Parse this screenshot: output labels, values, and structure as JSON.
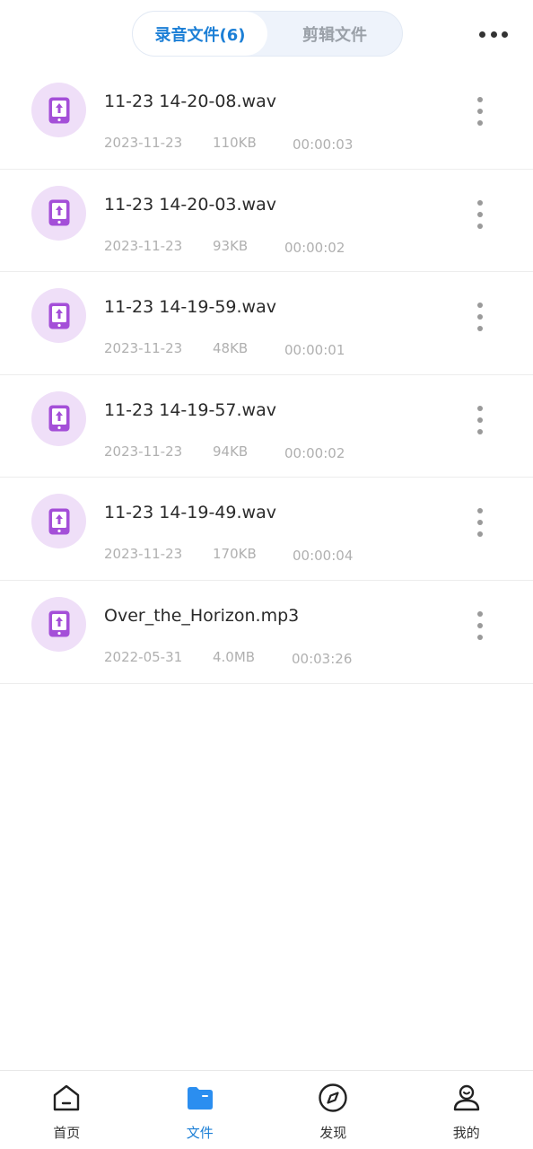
{
  "header": {
    "tabs": [
      {
        "label": "录音文件(6)",
        "active": true
      },
      {
        "label": "剪辑文件",
        "active": false
      }
    ],
    "more_icon": "more-horizontal-icon"
  },
  "files": [
    {
      "name": "11-23 14-20-08.wav",
      "date": "2023-11-23",
      "size": "110KB",
      "duration": "00:00:03"
    },
    {
      "name": "11-23 14-20-03.wav",
      "date": "2023-11-23",
      "size": "93KB",
      "duration": "00:00:02"
    },
    {
      "name": "11-23 14-19-59.wav",
      "date": "2023-11-23",
      "size": "48KB",
      "duration": "00:00:01"
    },
    {
      "name": "11-23 14-19-57.wav",
      "date": "2023-11-23",
      "size": "94KB",
      "duration": "00:00:02"
    },
    {
      "name": "11-23 14-19-49.wav",
      "date": "2023-11-23",
      "size": "170KB",
      "duration": "00:00:04"
    },
    {
      "name": "Over_the_Horizon.mp3",
      "date": "2022-05-31",
      "size": "4.0MB",
      "duration": "00:03:26"
    }
  ],
  "bottom_nav": {
    "items": [
      {
        "label": "首页",
        "icon": "home-icon",
        "active": false
      },
      {
        "label": "文件",
        "icon": "folder-icon",
        "active": true
      },
      {
        "label": "发现",
        "icon": "compass-icon",
        "active": false
      },
      {
        "label": "我的",
        "icon": "profile-icon",
        "active": false
      }
    ]
  },
  "colors": {
    "accent": "#1c7fd6",
    "file_icon_bg": "#efdff8",
    "file_icon_fg": "#a44fd8"
  }
}
